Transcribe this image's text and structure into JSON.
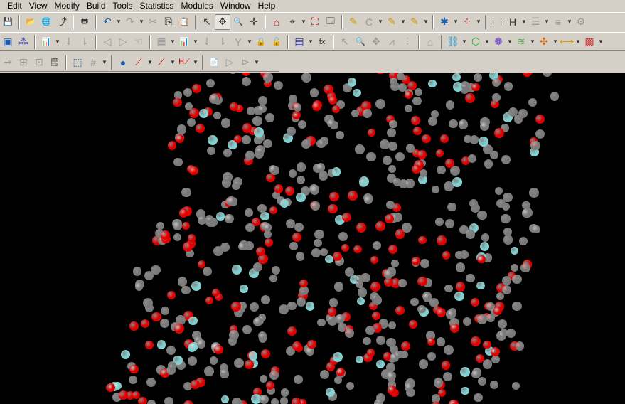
{
  "menubar": {
    "items": [
      "Edit",
      "View",
      "Modify",
      "Build",
      "Tools",
      "Statistics",
      "Modules",
      "Window",
      "Help"
    ]
  },
  "toolbar1": [
    {
      "icon": "save-icon",
      "g": "💾"
    },
    {
      "sep": 1
    },
    {
      "icon": "open-folder-icon",
      "g": "📂",
      "c": "#c9a400"
    },
    {
      "icon": "import-icon",
      "g": "🌐",
      "c": "#2a8"
    },
    {
      "icon": "export-icon",
      "g": "⤴"
    },
    {
      "sep": 1
    },
    {
      "icon": "print-icon",
      "g": "🖶"
    },
    {
      "sep": 1
    },
    {
      "icon": "undo-icon",
      "g": "↶",
      "c": "#1a5fb4",
      "dd": 1
    },
    {
      "icon": "redo-icon",
      "g": "↷",
      "dis": 1,
      "dd": 1
    },
    {
      "icon": "cut-icon",
      "g": "✂",
      "dis": 1
    },
    {
      "icon": "copy-icon",
      "g": "⎘"
    },
    {
      "icon": "paste-icon",
      "g": "📋",
      "dis": 1
    },
    {
      "sep": 1
    },
    {
      "icon": "select-arrow-icon",
      "g": "↖"
    },
    {
      "icon": "rotate-icon",
      "g": "✥",
      "pressed": 1
    },
    {
      "icon": "zoom-icon",
      "g": "🔍"
    },
    {
      "icon": "translate-icon",
      "g": "✛"
    },
    {
      "sep": 1
    },
    {
      "icon": "home-view-icon",
      "g": "⌂",
      "c": "#c00"
    },
    {
      "icon": "center-icon",
      "g": "⌖",
      "dd": 1
    },
    {
      "icon": "fit-screen-icon",
      "g": "⛶",
      "c": "#c00"
    },
    {
      "icon": "display-style-icon",
      "g": "🗔"
    },
    {
      "sep": 1
    },
    {
      "icon": "pencil-sketch-icon",
      "g": "✎",
      "c": "#c90"
    },
    {
      "icon": "ring-icon",
      "g": "C",
      "dis": 1,
      "dd": 1
    },
    {
      "icon": "sketch-ring-icon",
      "g": "✎",
      "c": "#c90",
      "dd": 1
    },
    {
      "icon": "sketch-chain-icon",
      "g": "✎",
      "c": "#c90",
      "dd": 1
    },
    {
      "sep": 1
    },
    {
      "icon": "clean-icon",
      "g": "✱",
      "c": "#1a5fb4",
      "dd": 1
    },
    {
      "icon": "atom-selection-icon",
      "g": "⁘",
      "c": "#c00",
      "dd": 1
    },
    {
      "sep": 1
    },
    {
      "icon": "hydrogens-icon",
      "g": "⋮⋮"
    },
    {
      "icon": "adjust-hydrogen-icon",
      "g": "H",
      "dd": 1
    },
    {
      "icon": "bond-icon",
      "g": "☰",
      "dis": 1,
      "dd": 1
    },
    {
      "icon": "list-icon",
      "g": "≡",
      "dis": 1,
      "dd": 1
    },
    {
      "icon": "more-icon",
      "g": "⚙",
      "dis": 1
    }
  ],
  "toolbar2": [
    {
      "icon": "crystal-build-icon",
      "g": "▣",
      "c": "#1a5fb4"
    },
    {
      "icon": "symmetry-icon",
      "g": "⁂",
      "c": "#33a"
    },
    {
      "sep": 1
    },
    {
      "icon": "chart-icon",
      "g": "📊",
      "dis": 1,
      "dd": 1
    },
    {
      "icon": "sort-ascending-icon",
      "g": "⇃",
      "dis": 1
    },
    {
      "icon": "sort-descending-icon",
      "g": "⇂",
      "dis": 1
    },
    {
      "sep": 1
    },
    {
      "icon": "previous-icon",
      "g": "◁",
      "dis": 1
    },
    {
      "icon": "next-icon",
      "g": "▷",
      "dis": 1
    },
    {
      "icon": "hand-icon",
      "g": "☜",
      "dis": 1
    },
    {
      "sep": 1
    },
    {
      "icon": "calculator-icon",
      "g": "▦",
      "dis": 1,
      "dd": 1
    },
    {
      "icon": "histogram-icon",
      "g": "📊",
      "dis": 1,
      "dd": 1
    },
    {
      "icon": "sort-az-icon",
      "g": "⇃",
      "dis": 1
    },
    {
      "icon": "sort-za-icon",
      "g": "⇂",
      "dis": 1
    },
    {
      "icon": "filter-icon",
      "g": "Y",
      "dis": 1,
      "dd": 1
    },
    {
      "icon": "lock-icon",
      "g": "🔒",
      "dis": 1
    },
    {
      "icon": "unlock-icon",
      "g": "🔓",
      "dis": 1
    },
    {
      "sep": 1
    },
    {
      "icon": "grid-icon",
      "g": "▤",
      "c": "#33a",
      "dd": 1
    },
    {
      "icon": "function-icon",
      "g": "fx"
    },
    {
      "sep": 1
    },
    {
      "icon": "pointer-icon",
      "g": "↖",
      "dis": 1
    },
    {
      "icon": "zoom-icon",
      "g": "🔍",
      "dis": 1
    },
    {
      "icon": "move-icon",
      "g": "✥",
      "dis": 1
    },
    {
      "icon": "spectrum-icon",
      "g": "⩘",
      "dis": 1
    },
    {
      "icon": "peak-icon",
      "g": "⫶",
      "dis": 1
    },
    {
      "sep": 1
    },
    {
      "icon": "home-icon",
      "g": "⌂",
      "dis": 1
    },
    {
      "sep": 1
    },
    {
      "icon": "amorphous-cell-icon",
      "g": "⛓",
      "c": "#1a8fd0",
      "dd": 1
    },
    {
      "icon": "forcite-icon",
      "g": "⬡",
      "c": "#2a2",
      "dd": 1
    },
    {
      "icon": "blends-icon",
      "g": "❁",
      "c": "#63c",
      "dd": 1
    },
    {
      "icon": "mesocite-icon",
      "g": "≋",
      "c": "#5a5",
      "dd": 1
    },
    {
      "icon": "sorption-icon",
      "g": "✣",
      "c": "#d60",
      "dd": 1
    },
    {
      "icon": "conformers-icon",
      "g": "⟷",
      "c": "#d90",
      "dd": 1
    },
    {
      "icon": "dftb-icon",
      "g": "▩",
      "c": "#c33",
      "dd": 1
    }
  ],
  "toolbar3": [
    {
      "icon": "import-data-icon",
      "g": "⇥",
      "dis": 1
    },
    {
      "icon": "insert-icon",
      "g": "⊞",
      "dis": 1
    },
    {
      "icon": "extract-icon",
      "g": "⊡",
      "dis": 1
    },
    {
      "icon": "properties-icon",
      "g": "🗒"
    },
    {
      "sep": 1
    },
    {
      "icon": "select-region-icon",
      "g": "⬚",
      "c": "#1a5fb4"
    },
    {
      "icon": "lattice-icon",
      "g": "#",
      "dis": 1,
      "dd": 1
    },
    {
      "sep": 1
    },
    {
      "icon": "add-atom-icon",
      "g": "●",
      "c": "#1a5fb4"
    },
    {
      "icon": "add-bond-icon",
      "g": "⟋",
      "c": "#c00",
      "dd": 1
    },
    {
      "icon": "modify-bond-icon",
      "g": "⟋",
      "c": "#c00",
      "dd": 1
    },
    {
      "icon": "hydrogen-bond-icon",
      "g": "H⟋",
      "c": "#c00",
      "dd": 1
    },
    {
      "sep": 1
    },
    {
      "icon": "script-icon",
      "g": "📄",
      "dis": 1
    },
    {
      "icon": "run-icon",
      "g": "▷",
      "dis": 1
    },
    {
      "icon": "debug-icon",
      "g": "⊳",
      "dis": 1,
      "dd": 1
    }
  ],
  "viewport": {
    "background": "#000000",
    "atom_colors": {
      "oxygen": "#e00000",
      "carbon": "#7a7a7a",
      "hydrogen": "#7fd0d0"
    }
  }
}
